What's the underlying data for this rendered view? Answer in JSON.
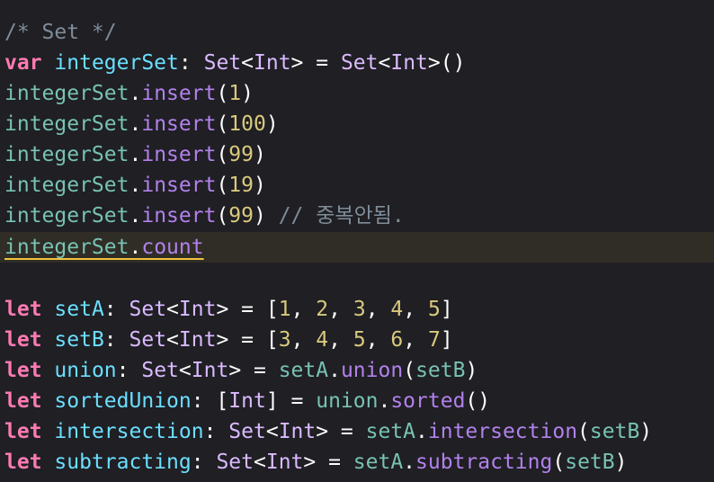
{
  "lines": [
    [
      {
        "t": "/* Set */",
        "c": "cm"
      }
    ],
    [
      {
        "t": "var",
        "c": "kw"
      },
      {
        "t": " ",
        "c": "pl"
      },
      {
        "t": "integerSet",
        "c": "decl"
      },
      {
        "t": ": ",
        "c": "pl"
      },
      {
        "t": "Set",
        "c": "ty"
      },
      {
        "t": "<",
        "c": "pl"
      },
      {
        "t": "Int",
        "c": "ty"
      },
      {
        "t": "> = ",
        "c": "pl"
      },
      {
        "t": "Set",
        "c": "ty"
      },
      {
        "t": "<",
        "c": "pl"
      },
      {
        "t": "Int",
        "c": "ty"
      },
      {
        "t": ">()",
        "c": "pl"
      }
    ],
    [
      {
        "t": "integerSet",
        "c": "var"
      },
      {
        "t": ".",
        "c": "pl"
      },
      {
        "t": "insert",
        "c": "fn"
      },
      {
        "t": "(",
        "c": "pl"
      },
      {
        "t": "1",
        "c": "num"
      },
      {
        "t": ")",
        "c": "pl"
      }
    ],
    [
      {
        "t": "integerSet",
        "c": "var"
      },
      {
        "t": ".",
        "c": "pl"
      },
      {
        "t": "insert",
        "c": "fn"
      },
      {
        "t": "(",
        "c": "pl"
      },
      {
        "t": "100",
        "c": "num"
      },
      {
        "t": ")",
        "c": "pl"
      }
    ],
    [
      {
        "t": "integerSet",
        "c": "var"
      },
      {
        "t": ".",
        "c": "pl"
      },
      {
        "t": "insert",
        "c": "fn"
      },
      {
        "t": "(",
        "c": "pl"
      },
      {
        "t": "99",
        "c": "num"
      },
      {
        "t": ")",
        "c": "pl"
      }
    ],
    [
      {
        "t": "integerSet",
        "c": "var"
      },
      {
        "t": ".",
        "c": "pl"
      },
      {
        "t": "insert",
        "c": "fn"
      },
      {
        "t": "(",
        "c": "pl"
      },
      {
        "t": "19",
        "c": "num"
      },
      {
        "t": ")",
        "c": "pl"
      }
    ],
    [
      {
        "t": "integerSet",
        "c": "var"
      },
      {
        "t": ".",
        "c": "pl"
      },
      {
        "t": "insert",
        "c": "fn"
      },
      {
        "t": "(",
        "c": "pl"
      },
      {
        "t": "99",
        "c": "num"
      },
      {
        "t": ") ",
        "c": "pl"
      },
      {
        "t": "// 중복안됨.",
        "c": "cm"
      }
    ],
    [
      {
        "t": "integerSet",
        "c": "var"
      },
      {
        "t": ".",
        "c": "pl"
      },
      {
        "t": "count",
        "c": "fn"
      }
    ],
    [],
    [
      {
        "t": "let",
        "c": "kw"
      },
      {
        "t": " ",
        "c": "pl"
      },
      {
        "t": "setA",
        "c": "decl"
      },
      {
        "t": ": ",
        "c": "pl"
      },
      {
        "t": "Set",
        "c": "ty"
      },
      {
        "t": "<",
        "c": "pl"
      },
      {
        "t": "Int",
        "c": "ty"
      },
      {
        "t": "> = [",
        "c": "pl"
      },
      {
        "t": "1",
        "c": "num"
      },
      {
        "t": ", ",
        "c": "pl"
      },
      {
        "t": "2",
        "c": "num"
      },
      {
        "t": ", ",
        "c": "pl"
      },
      {
        "t": "3",
        "c": "num"
      },
      {
        "t": ", ",
        "c": "pl"
      },
      {
        "t": "4",
        "c": "num"
      },
      {
        "t": ", ",
        "c": "pl"
      },
      {
        "t": "5",
        "c": "num"
      },
      {
        "t": "]",
        "c": "pl"
      }
    ],
    [
      {
        "t": "let",
        "c": "kw"
      },
      {
        "t": " ",
        "c": "pl"
      },
      {
        "t": "setB",
        "c": "decl"
      },
      {
        "t": ": ",
        "c": "pl"
      },
      {
        "t": "Set",
        "c": "ty"
      },
      {
        "t": "<",
        "c": "pl"
      },
      {
        "t": "Int",
        "c": "ty"
      },
      {
        "t": "> = [",
        "c": "pl"
      },
      {
        "t": "3",
        "c": "num"
      },
      {
        "t": ", ",
        "c": "pl"
      },
      {
        "t": "4",
        "c": "num"
      },
      {
        "t": ", ",
        "c": "pl"
      },
      {
        "t": "5",
        "c": "num"
      },
      {
        "t": ", ",
        "c": "pl"
      },
      {
        "t": "6",
        "c": "num"
      },
      {
        "t": ", ",
        "c": "pl"
      },
      {
        "t": "7",
        "c": "num"
      },
      {
        "t": "]",
        "c": "pl"
      }
    ],
    [
      {
        "t": "let",
        "c": "kw"
      },
      {
        "t": " ",
        "c": "pl"
      },
      {
        "t": "union",
        "c": "decl"
      },
      {
        "t": ": ",
        "c": "pl"
      },
      {
        "t": "Set",
        "c": "ty"
      },
      {
        "t": "<",
        "c": "pl"
      },
      {
        "t": "Int",
        "c": "ty"
      },
      {
        "t": "> = ",
        "c": "pl"
      },
      {
        "t": "setA",
        "c": "var"
      },
      {
        "t": ".",
        "c": "pl"
      },
      {
        "t": "union",
        "c": "fn"
      },
      {
        "t": "(",
        "c": "pl"
      },
      {
        "t": "setB",
        "c": "var"
      },
      {
        "t": ")",
        "c": "pl"
      }
    ],
    [
      {
        "t": "let",
        "c": "kw"
      },
      {
        "t": " ",
        "c": "pl"
      },
      {
        "t": "sortedUnion",
        "c": "decl"
      },
      {
        "t": ": [",
        "c": "pl"
      },
      {
        "t": "Int",
        "c": "ty"
      },
      {
        "t": "] = ",
        "c": "pl"
      },
      {
        "t": "union",
        "c": "var"
      },
      {
        "t": ".",
        "c": "pl"
      },
      {
        "t": "sorted",
        "c": "fn"
      },
      {
        "t": "()",
        "c": "pl"
      }
    ],
    [
      {
        "t": "let",
        "c": "kw"
      },
      {
        "t": " ",
        "c": "pl"
      },
      {
        "t": "intersection",
        "c": "decl"
      },
      {
        "t": ": ",
        "c": "pl"
      },
      {
        "t": "Set",
        "c": "ty"
      },
      {
        "t": "<",
        "c": "pl"
      },
      {
        "t": "Int",
        "c": "ty"
      },
      {
        "t": "> = ",
        "c": "pl"
      },
      {
        "t": "setA",
        "c": "var"
      },
      {
        "t": ".",
        "c": "pl"
      },
      {
        "t": "intersection",
        "c": "fn"
      },
      {
        "t": "(",
        "c": "pl"
      },
      {
        "t": "setB",
        "c": "var"
      },
      {
        "t": ")",
        "c": "pl"
      }
    ],
    [
      {
        "t": "let",
        "c": "kw"
      },
      {
        "t": " ",
        "c": "pl"
      },
      {
        "t": "subtracting",
        "c": "decl"
      },
      {
        "t": ": ",
        "c": "pl"
      },
      {
        "t": "Set",
        "c": "ty"
      },
      {
        "t": "<",
        "c": "pl"
      },
      {
        "t": "Int",
        "c": "ty"
      },
      {
        "t": "> = ",
        "c": "pl"
      },
      {
        "t": "setA",
        "c": "var"
      },
      {
        "t": ".",
        "c": "pl"
      },
      {
        "t": "subtracting",
        "c": "fn"
      },
      {
        "t": "(",
        "c": "pl"
      },
      {
        "t": "setB",
        "c": "var"
      },
      {
        "t": ")",
        "c": "pl"
      }
    ]
  ],
  "current_line": 8,
  "colors": {
    "background": "#1f1f24",
    "current_line_highlight": "#2f2d26",
    "underline": "#f0c33c",
    "keyword": "#ff7ab2",
    "declaration": "#6bdfff",
    "type": "#dabaff",
    "variable": "#78c2b3",
    "function": "#b281eb",
    "number": "#d9c97c",
    "comment": "#7f8c98",
    "plain": "#ffffff"
  }
}
